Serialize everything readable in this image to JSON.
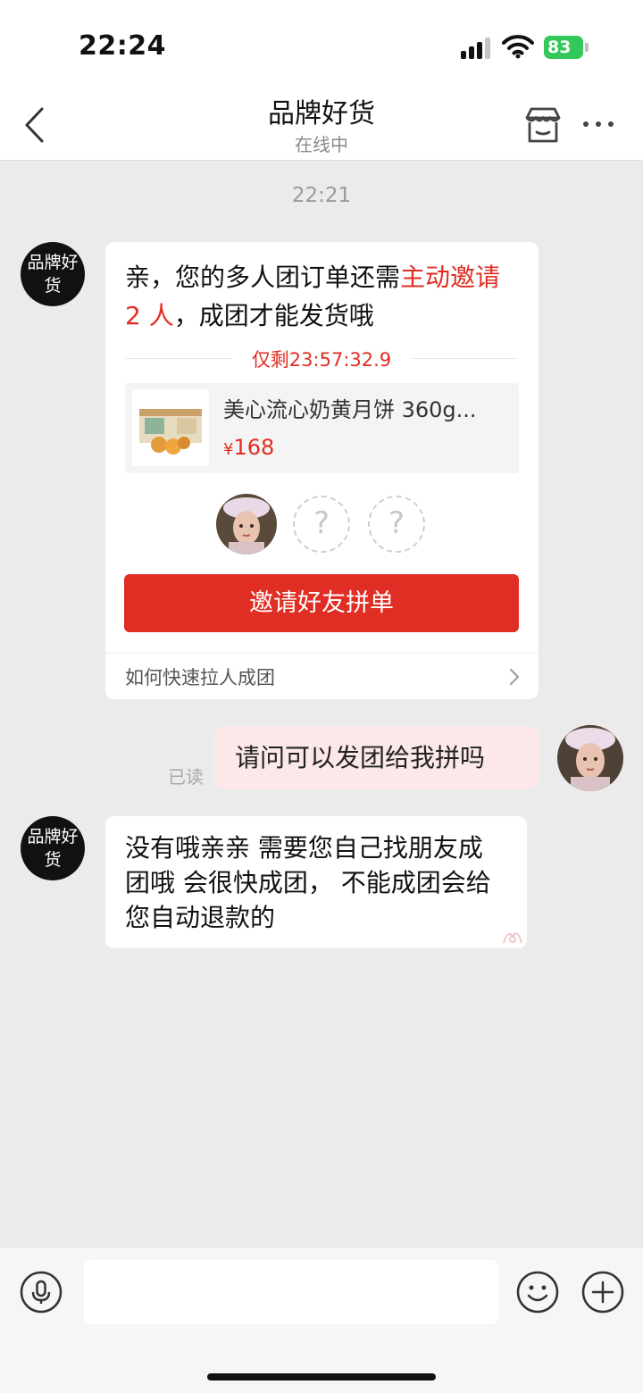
{
  "status_bar": {
    "time": "22:24",
    "battery": "83"
  },
  "header": {
    "title": "品牌好货",
    "subtitle": "在线中"
  },
  "chat": {
    "timestamp": "22:21",
    "shop_avatar_text": "品牌好货",
    "group_card": {
      "message_prefix": "亲，您的多人团订单还需",
      "message_highlight": "主动邀请 2 人",
      "message_suffix": "，成团才能发货哦",
      "countdown": "仅剩23:57:32.9",
      "product": {
        "name": "美心流心奶黄月饼 360g...",
        "currency": "¥",
        "price": "168"
      },
      "members": {
        "filled": 1,
        "empty_symbol": "?"
      },
      "invite_button": "邀请好友拼单",
      "help_link": "如何快速拉人成团"
    },
    "my_message": {
      "text": "请问可以发团给我拼吗",
      "read_status": "已读"
    },
    "reply_message": {
      "text": "没有哦亲亲 需要您自己找朋友成团哦 会很快成团， 不能成团会给您自动退款的"
    }
  },
  "input_bar": {
    "placeholder": ""
  },
  "colors": {
    "accent": "#e02e24",
    "my_bubble": "#fce8e8",
    "background": "#ebebeb"
  }
}
